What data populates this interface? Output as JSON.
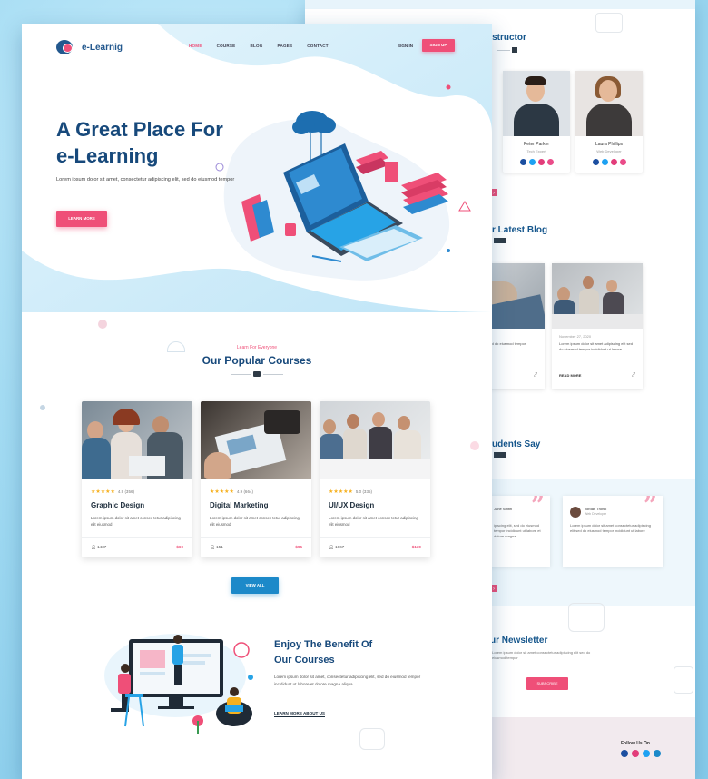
{
  "brand": {
    "name": "e-Learnig"
  },
  "nav": {
    "items": [
      "HOME",
      "COURSE",
      "BLOG",
      "PAGES",
      "CONTACT"
    ],
    "active_index": 0,
    "signin": "SIGN IN",
    "signup": "SIGN UP"
  },
  "hero": {
    "title_line1": "A Great Place For",
    "title_line2": "e-Learning",
    "subtitle": "Lorem ipsum dolor sit amet, consectetur adipiscing elit, sed do eiusmod tempor",
    "cta": "LEARN MORE"
  },
  "courses_section": {
    "tag": "Learn For Everyone",
    "title": "Our Popular Courses",
    "courses": [
      {
        "title": "Graphic Design",
        "rating": "4.9",
        "reviews": "(356)",
        "desc": "Lorem ipsum dolor sit amet consec tetur adipiscing elit eiusmod",
        "students": "1437",
        "price": "$69"
      },
      {
        "title": "Digital Marketing",
        "rating": "4.9",
        "reviews": "(664)",
        "desc": "Lorem ipsum dolor sit amet consec tetur adipiscing elit eiusmod",
        "students": "151",
        "price": "$95"
      },
      {
        "title": "UI/UX Design",
        "rating": "5.0",
        "reviews": "(335)",
        "desc": "Lorem ipsum dolor sit amet consec tetur adipiscing elit eiusmod",
        "students": "1067",
        "price": "$130"
      }
    ],
    "view_all": "VIEW ALL"
  },
  "benefit": {
    "title_line1": "Enjoy The Benefit Of",
    "title_line2": "Our Courses",
    "desc": "Lorem ipsum dolor sit amet, consectetur adipiscing elit, sed do eiusmod tempor incididunt ut labore et dolore magna aliqua.",
    "link": "LEARN MORE ABOUT US"
  },
  "back_page": {
    "instructor_title": "nstructor",
    "instructors": [
      {
        "name": "Peter Parker",
        "role": "Tech Expert"
      },
      {
        "name": "Laura Phillips",
        "role": "Web Developer"
      }
    ],
    "blog_title": "r Latest Blog",
    "blog_posts": [
      {
        "meta": "",
        "text": "s adipiscing elit, sed do eiusmod tempor incididunt",
        "more": ""
      },
      {
        "meta": "November 27, 2020",
        "text": "Lorem ipsum dolor sit amet adipiscing elit sed do eiusmod tempor incididunt ut labore",
        "more": "READ MORE"
      }
    ],
    "testimonial_title": "udents Say",
    "testimonials": [
      {
        "name": "Jane Smith",
        "role": "",
        "text": "ipiscing elit, sed do eiusmod tempor incididunt ut labore et dolore magna"
      },
      {
        "name": "Jordan Tronik",
        "role": "Web Developer",
        "text": "Lorem ipsum dolor sit amet consectetur adipiscing elit sed do eiusmod tempor incididunt ut labore"
      }
    ],
    "newsletter_title": "ur Newsletter",
    "newsletter_text": "Lorem ipsum dolor sit amet consectetur adipiscing elit sed do eiusmod tempor",
    "newsletter_btn": "SUBSCRIBE",
    "follow": "Follow Us On"
  },
  "colors": {
    "primary": "#17497b",
    "accent": "#ef4f78",
    "button_blue": "#1c89c9",
    "star": "#f6b01e",
    "frame_bg": "#8fd0ee"
  }
}
